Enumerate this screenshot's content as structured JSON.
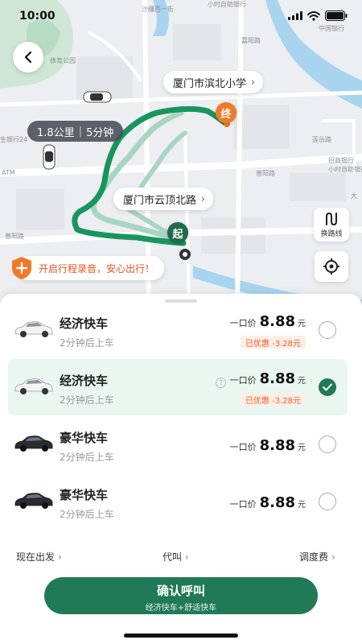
{
  "status_bar": {
    "time": "10:00"
  },
  "map": {
    "destination_label": "厦门市滨北小学",
    "pickup_label": "厦门市云顶北路",
    "distance": "1.8公里",
    "duration": "5分钟",
    "start_marker": "起",
    "end_marker": "终",
    "route_switch_label": "换路线",
    "record_prompt": "开启行程录音，安心出行！",
    "street_labels": {
      "a": "沙缰西一街",
      "b": "小时自助银行",
      "c": "中国银行",
      "d": "体育公园",
      "e": "嘉阳路",
      "f": "莲岳路",
      "g": "普阳路",
      "h": "招商银行",
      "i": "小时自助银行",
      "j": "生银行24",
      "k": "ATM",
      "l": "大"
    },
    "colors": {
      "route": "#18955f",
      "route_alt": "#a8d5c1",
      "water": "#a9d4f0",
      "park": "#cfe6d6"
    }
  },
  "rides": [
    {
      "name": "经济快车",
      "eta": "2分钟后上车",
      "price_label": "一口价",
      "price": "8.88",
      "unit": "元",
      "discount": "已优惠 -3.28元",
      "selected": false,
      "car": "white-car-icon"
    },
    {
      "name": "经济快车",
      "eta": "2分钟后上车",
      "price_label": "一口价",
      "price": "8.88",
      "unit": "元",
      "discount": "已优惠 -3.28元",
      "selected": true,
      "car": "white-car-icon",
      "help": "?"
    },
    {
      "name": "豪华快车",
      "eta": "2分钟后上车",
      "price_label": "一口价",
      "price": "8.88",
      "unit": "元",
      "selected": false,
      "car": "black-car-icon"
    },
    {
      "name": "豪华快车",
      "eta": "2分钟后上车",
      "price_label": "一口价",
      "price": "8.88",
      "unit": "元",
      "selected": false,
      "car": "black-car-icon"
    }
  ],
  "options": {
    "depart_now": "现在出发",
    "call_for_others": "代叫",
    "dispatch_fee": "调度费"
  },
  "confirm": {
    "title": "确认呼叫",
    "subtitle": "经济快车+舒适快车",
    "color": "#1f7a55"
  }
}
